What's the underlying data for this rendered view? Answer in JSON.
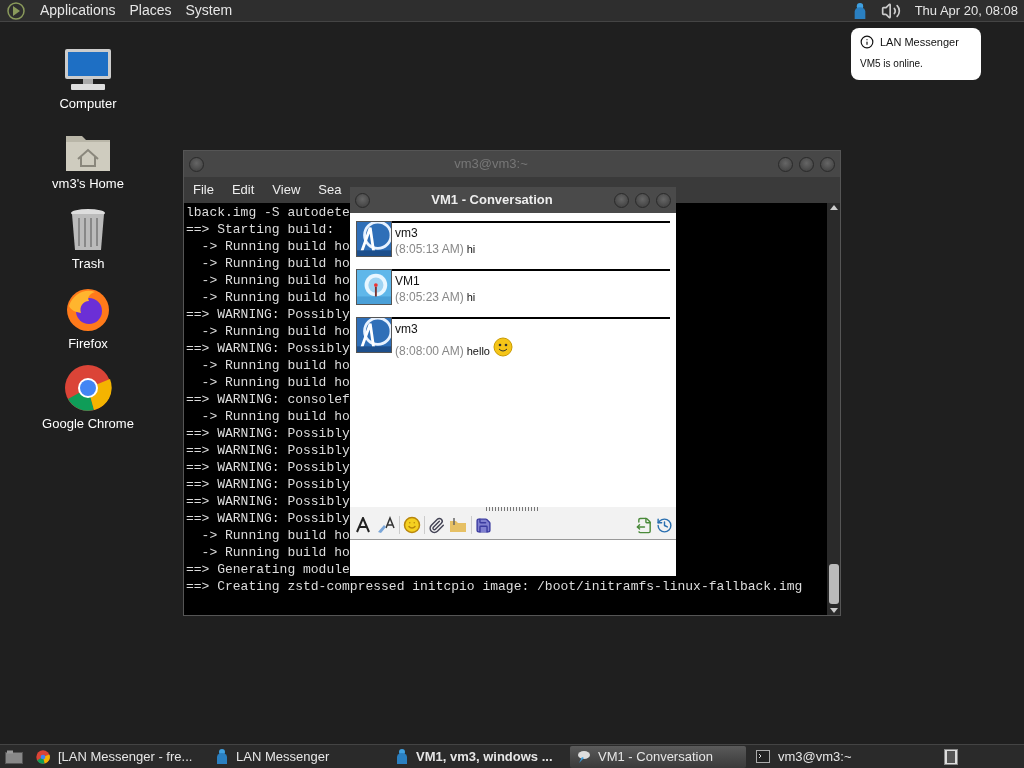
{
  "top_panel": {
    "menus": [
      "Applications",
      "Places",
      "System"
    ],
    "clock": "Thu Apr 20, 08:08"
  },
  "notification": {
    "title": "LAN Messenger",
    "body": "VM5 is online."
  },
  "desktop_icons": [
    {
      "label": "Computer",
      "kind": "computer"
    },
    {
      "label": "vm3's Home",
      "kind": "home"
    },
    {
      "label": "Trash",
      "kind": "trash"
    },
    {
      "label": "Firefox",
      "kind": "firefox"
    },
    {
      "label": "Google Chrome",
      "kind": "chrome"
    }
  ],
  "terminal": {
    "title": "vm3@vm3:~",
    "menus": [
      "File",
      "Edit",
      "View",
      "Sea"
    ],
    "lines": [
      "lback.img -S autodete",
      "==> Starting build:",
      "  -> Running build ho",
      "  -> Running build ho",
      "  -> Running build ho",
      "  -> Running build ho",
      "==> WARNING: Possibly",
      "  -> Running build ho",
      "==> WARNING: Possibly",
      "  -> Running build ho",
      "  -> Running build ho",
      "==> WARNING: consolef",
      "  -> Running build ho",
      "==> WARNING: Possibly",
      "==> WARNING: Possibly",
      "==> WARNING: Possibly",
      "==> WARNING: Possibly",
      "==> WARNING: Possibly",
      "==> WARNING: Possibly",
      "  -> Running build ho",
      "  -> Running build ho",
      "==> Generating module",
      "==> Creating zstd-compressed initcpio image: /boot/initramfs-linux-fallback.img"
    ]
  },
  "conversation": {
    "title": "VM1 - Conversation",
    "messages": [
      {
        "sender": "vm3",
        "time": "(8:05:13 AM)",
        "text": "hi",
        "emoticon": false
      },
      {
        "sender": "VM1",
        "time": "(8:05:23 AM)",
        "text": "hi",
        "emoticon": false
      },
      {
        "sender": "vm3",
        "time": "(8:08:00 AM)",
        "text": "hello",
        "emoticon": true
      }
    ]
  },
  "taskbar": {
    "items": [
      {
        "label": "[LAN Messenger - fre...",
        "kind": "chrome",
        "selected": false,
        "attention": false
      },
      {
        "label": "LAN Messenger",
        "kind": "messenger",
        "selected": false,
        "attention": false
      },
      {
        "label": "VM1, vm3, windows ...",
        "kind": "messenger",
        "selected": false,
        "attention": true
      },
      {
        "label": "VM1 - Conversation",
        "kind": "chat",
        "selected": true,
        "attention": false
      },
      {
        "label": "vm3@vm3:~",
        "kind": "terminal",
        "selected": false,
        "attention": false
      }
    ]
  }
}
